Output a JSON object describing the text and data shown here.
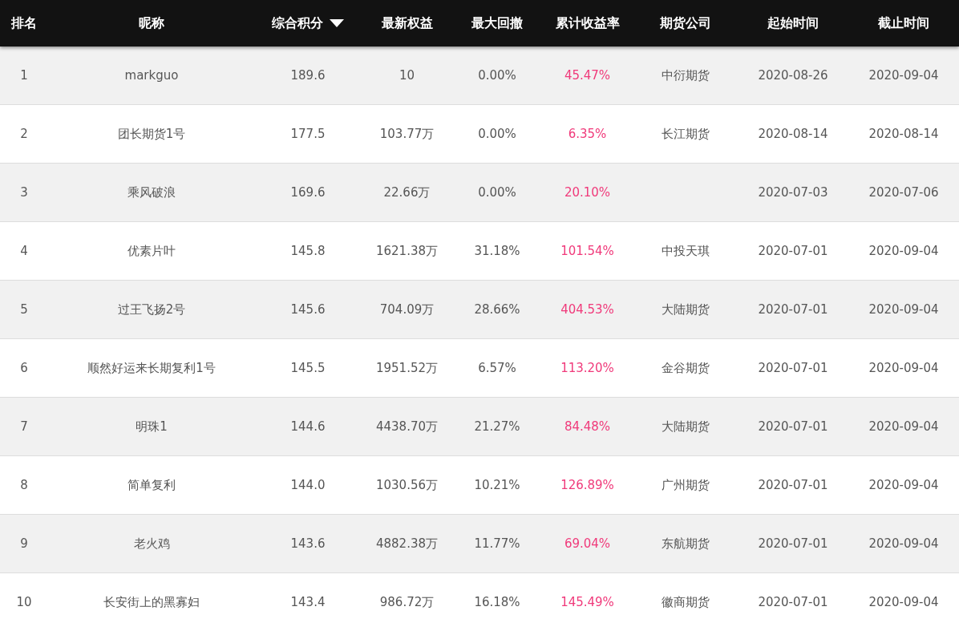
{
  "table": {
    "columns": [
      {
        "label": "排名",
        "sorted": false
      },
      {
        "label": "昵称",
        "sorted": false
      },
      {
        "label": "综合积分",
        "sorted": true
      },
      {
        "label": "最新权益",
        "sorted": false
      },
      {
        "label": "最大回撤",
        "sorted": false
      },
      {
        "label": "累计收益率",
        "sorted": false
      },
      {
        "label": "期货公司",
        "sorted": false
      },
      {
        "label": "起始时间",
        "sorted": false
      },
      {
        "label": "截止时间",
        "sorted": false
      }
    ],
    "rows": [
      {
        "rank": "1",
        "nickname": "markguo",
        "score": "189.6",
        "equity": "10",
        "drawdown": "0.00%",
        "return": "45.47%",
        "company": "中衍期货",
        "start": "2020-08-26",
        "end": "2020-09-04"
      },
      {
        "rank": "2",
        "nickname": "团长期货1号",
        "score": "177.5",
        "equity": "103.77万",
        "drawdown": "0.00%",
        "return": "6.35%",
        "company": "长江期货",
        "start": "2020-08-14",
        "end": "2020-08-14"
      },
      {
        "rank": "3",
        "nickname": "乘风破浪",
        "score": "169.6",
        "equity": "22.66万",
        "drawdown": "0.00%",
        "return": "20.10%",
        "start": "2020-07-03",
        "end": "2020-07-06"
      },
      {
        "rank": "4",
        "nickname": "优素片叶",
        "score": "145.8",
        "equity": "1621.38万",
        "drawdown": "31.18%",
        "return": "101.54%",
        "company": "中投天琪",
        "start": "2020-07-01",
        "end": "2020-09-04"
      },
      {
        "rank": "5",
        "nickname": "过王飞扬2号",
        "score": "145.6",
        "equity": "704.09万",
        "drawdown": "28.66%",
        "return": "404.53%",
        "company": "大陆期货",
        "start": "2020-07-01",
        "end": "2020-09-04"
      },
      {
        "rank": "6",
        "nickname": "顺然好运来长期复利1号",
        "score": "145.5",
        "equity": "1951.52万",
        "drawdown": "6.57%",
        "return": "113.20%",
        "company": "金谷期货",
        "start": "2020-07-01",
        "end": "2020-09-04"
      },
      {
        "rank": "7",
        "nickname": "明珠1",
        "score": "144.6",
        "equity": "4438.70万",
        "drawdown": "21.27%",
        "return": "84.48%",
        "company": "大陆期货",
        "start": "2020-07-01",
        "end": "2020-09-04"
      },
      {
        "rank": "8",
        "nickname": "简单复利",
        "score": "144.0",
        "equity": "1030.56万",
        "drawdown": "10.21%",
        "return": "126.89%",
        "company": "广州期货",
        "start": "2020-07-01",
        "end": "2020-09-04"
      },
      {
        "rank": "9",
        "nickname": "老火鸡",
        "score": "143.6",
        "equity": "4882.38万",
        "drawdown": "11.77%",
        "return": "69.04%",
        "company": "东航期货",
        "start": "2020-07-01",
        "end": "2020-09-04"
      },
      {
        "rank": "10",
        "nickname": "长安街上的黑寡妇",
        "score": "143.4",
        "equity": "986.72万",
        "drawdown": "16.18%",
        "return": "145.49%",
        "company": "徽商期货",
        "start": "2020-07-01",
        "end": "2020-09-04"
      }
    ]
  }
}
